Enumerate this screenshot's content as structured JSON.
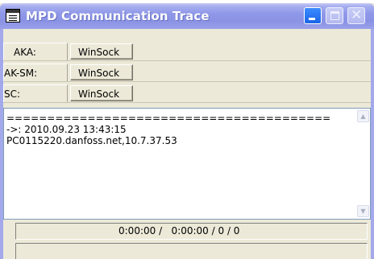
{
  "window": {
    "title": "MPD Communication Trace"
  },
  "connections": [
    {
      "label": "AKA:",
      "value": "WinSock"
    },
    {
      "label": "AK-SM:",
      "value": "WinSock"
    },
    {
      "label": "SC:",
      "value": "WinSock"
    }
  ],
  "log": {
    "lines": "========================================\n->: 2010.09.23 13:43:15\nPC0115220.danfoss.net,10.7.37.53"
  },
  "status": {
    "text": "0:00:00 /   0:00:00 / 0 / 0",
    "secondary": ""
  },
  "icons": {
    "app": "trace-app-icon",
    "minimize": "minimize-icon",
    "maximize": "maximize-icon",
    "close": "close-icon",
    "scroll_up": "scroll-up-arrow-icon",
    "scroll_down": "scroll-down-arrow-icon"
  },
  "colors": {
    "titlebar": "#8f98e8",
    "minimize_button": "#2a74f0",
    "face": "#ece9d8"
  }
}
